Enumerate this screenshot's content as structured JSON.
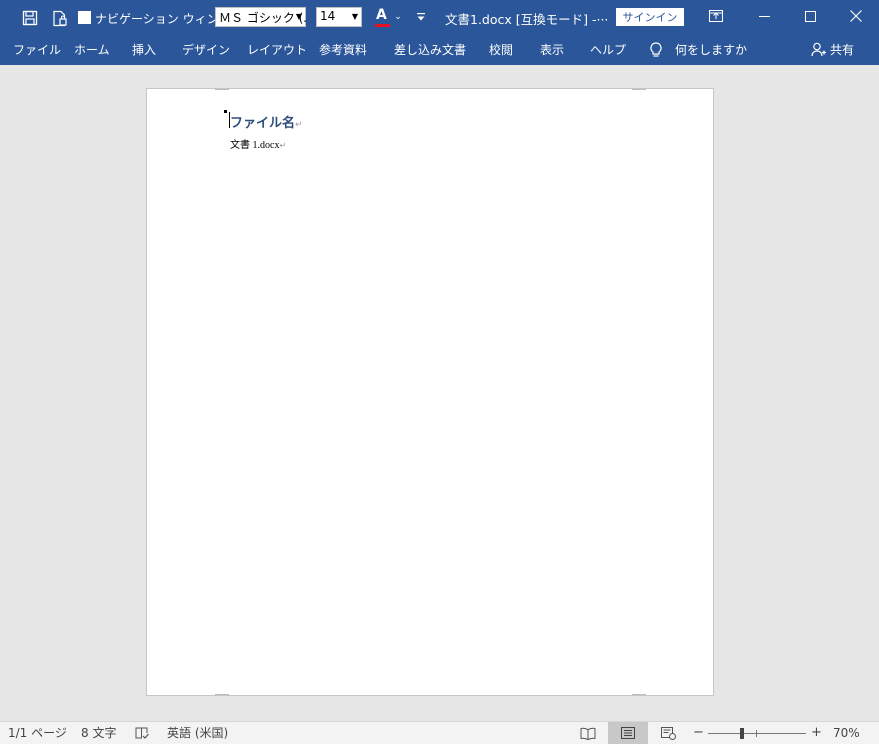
{
  "colors": {
    "brand": "#2b579a",
    "heading": "#2e4d7b",
    "status_bg": "#f3f3f3"
  },
  "titlebar": {
    "nav_pane_label": "ナビゲーション ウィンドウ",
    "font_name": "ＭＳ ゴシック (.",
    "font_size": "14",
    "font_color_letter": "A",
    "doc_title": "文書1.docx [互換モード]  -···",
    "signin_label": "サインイン"
  },
  "ribbon": {
    "tabs": [
      "ファイル",
      "ホーム",
      "挿入",
      "デザイン",
      "レイアウト",
      "参考資料",
      "差し込み文書",
      "校閲",
      "表示",
      "ヘルプ"
    ],
    "tellme": "何をしますか",
    "share": "共有"
  },
  "document": {
    "heading": "ファイル名",
    "body": "文書 1.docx"
  },
  "status": {
    "page": "1/1 ページ",
    "words": "8 文字",
    "language": "英語 (米国)",
    "zoom_minus": "−",
    "zoom_plus": "+",
    "zoom": "70%",
    "zoom_level_percent": 70
  }
}
